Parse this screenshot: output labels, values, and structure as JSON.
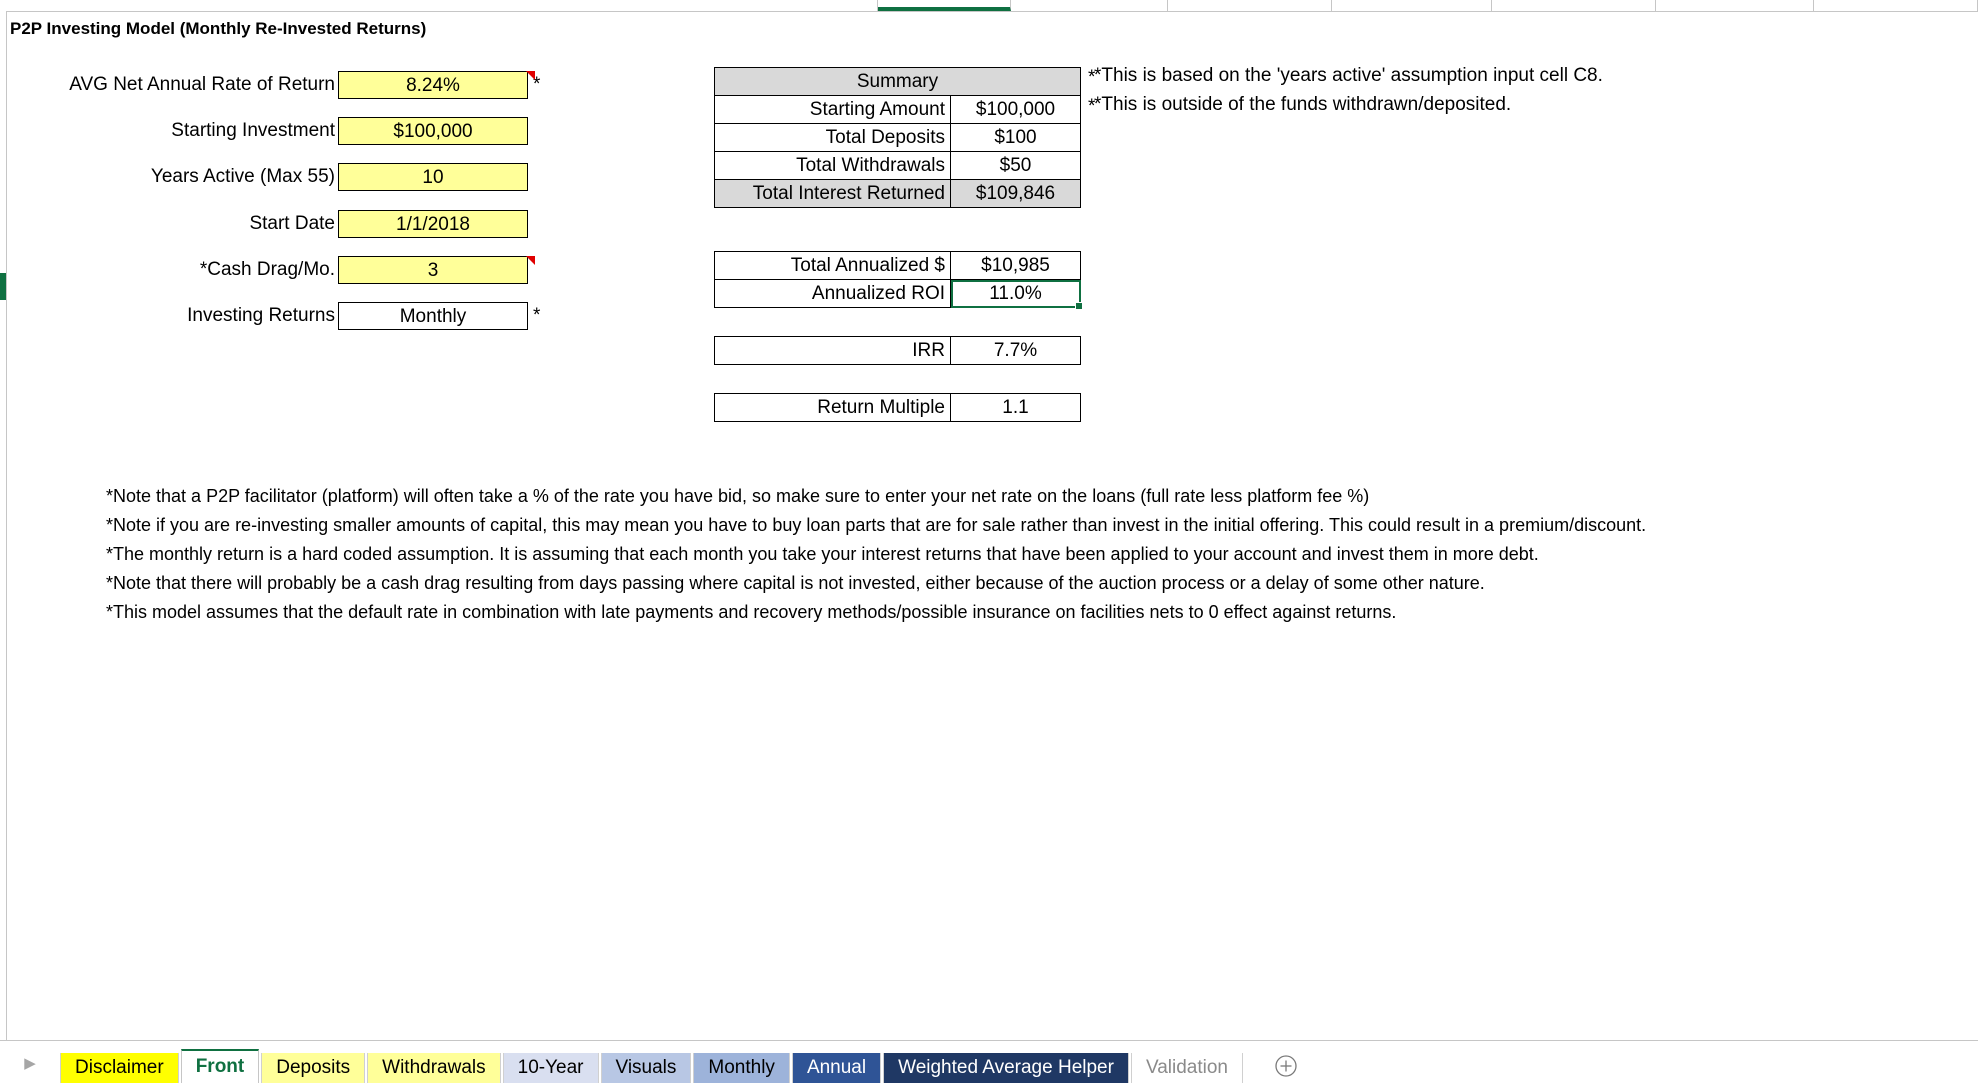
{
  "title": "P2P Investing Model (Monthly Re-Invested Returns)",
  "colors": {
    "input_fill": "#ffff99",
    "header_fill": "#d9d9d9",
    "selection_green": "#0f7041",
    "comment_red": "#e00000"
  },
  "inputs": [
    {
      "label": "AVG Net Annual Rate of Return",
      "value": "8.24%",
      "filled": true,
      "comment": true,
      "star": "*"
    },
    {
      "label": "Starting Investment",
      "value": "$100,000",
      "filled": true,
      "comment": false,
      "star": ""
    },
    {
      "label": "Years Active (Max 55)",
      "value": "10",
      "filled": true,
      "comment": false,
      "star": ""
    },
    {
      "label": "Start Date",
      "value": "1/1/2018",
      "filled": true,
      "comment": false,
      "star": ""
    },
    {
      "label": "*Cash Drag/Mo.",
      "value": "3",
      "filled": true,
      "comment": true,
      "star": ""
    },
    {
      "label": "Investing Returns",
      "value": "Monthly",
      "filled": false,
      "comment": false,
      "star": "*"
    }
  ],
  "summary": {
    "header": "Summary",
    "rows": [
      {
        "label": "Starting Amount",
        "value": "$100,000",
        "shaded": false
      },
      {
        "label": "Total Deposits",
        "value": "$100",
        "shaded": false
      },
      {
        "label": "Total Withdrawals",
        "value": "$50",
        "shaded": false
      },
      {
        "label": "Total Interest Returned",
        "value": "$109,846",
        "shaded": true
      }
    ]
  },
  "metrics": {
    "annualized": [
      {
        "label": "Total Annualized $",
        "value": "$10,985",
        "selected": false
      },
      {
        "label": "Annualized ROI",
        "value": "11.0%",
        "selected": true
      }
    ],
    "irr": {
      "label": "IRR",
      "value": "7.7%"
    },
    "multiple": {
      "label": "Return Multiple",
      "value": "1.1"
    }
  },
  "annotations": [
    "*This is based on the 'years active' assumption input cell C8.",
    "*This is outside of the funds withdrawn/deposited."
  ],
  "table_stars": [
    "*",
    "*"
  ],
  "notes": [
    "*Note that a P2P facilitator (platform) will often take a % of the rate you have bid, so make sure to enter your net rate on the loans (full rate less platform fee %)",
    "*Note if you are re-investing smaller amounts of capital, this may mean you have to buy loan parts that are for sale rather than invest in the initial offering. This could result in a premium/discount.",
    "*The monthly return is a hard coded assumption. It is assuming that each month you take your interest returns that have been applied to your account and invest them in more debt.",
    "*Note that there will probably be a cash drag resulting from days passing where capital is not invested, either because of the auction process or a delay of some other nature.",
    "*This model assumes that the default rate in combination with late payments and recovery methods/possible insurance on facilities nets to 0 effect against returns."
  ],
  "tabs": [
    {
      "label": "Disclaimer",
      "bg": "#ffff00",
      "fg": "#000000",
      "state": "normal"
    },
    {
      "label": "Front",
      "bg": "#ffffff",
      "fg": "#0f7041",
      "state": "active"
    },
    {
      "label": "Deposits",
      "bg": "#ffff99",
      "fg": "#000000",
      "state": "normal"
    },
    {
      "label": "Withdrawals",
      "bg": "#ffff99",
      "fg": "#000000",
      "state": "normal"
    },
    {
      "label": "10-Year",
      "bg": "#d9dff0",
      "fg": "#000000",
      "state": "normal"
    },
    {
      "label": "Visuals",
      "bg": "#b8c7e4",
      "fg": "#000000",
      "state": "normal"
    },
    {
      "label": "Monthly",
      "bg": "#9db3da",
      "fg": "#000000",
      "state": "normal"
    },
    {
      "label": "Annual",
      "bg": "#2f5496",
      "fg": "#ffffff",
      "state": "normal"
    },
    {
      "label": "Weighted Average Helper",
      "bg": "#1f3864",
      "fg": "#ffffff",
      "state": "normal"
    },
    {
      "label": "Validation",
      "bg": "#ffffff",
      "fg": "#8a8a8a",
      "state": "dim"
    }
  ],
  "tabbar": {
    "scroll_icon": "chevron-right-icon",
    "add_sheet_icon": "plus-circle-icon"
  }
}
